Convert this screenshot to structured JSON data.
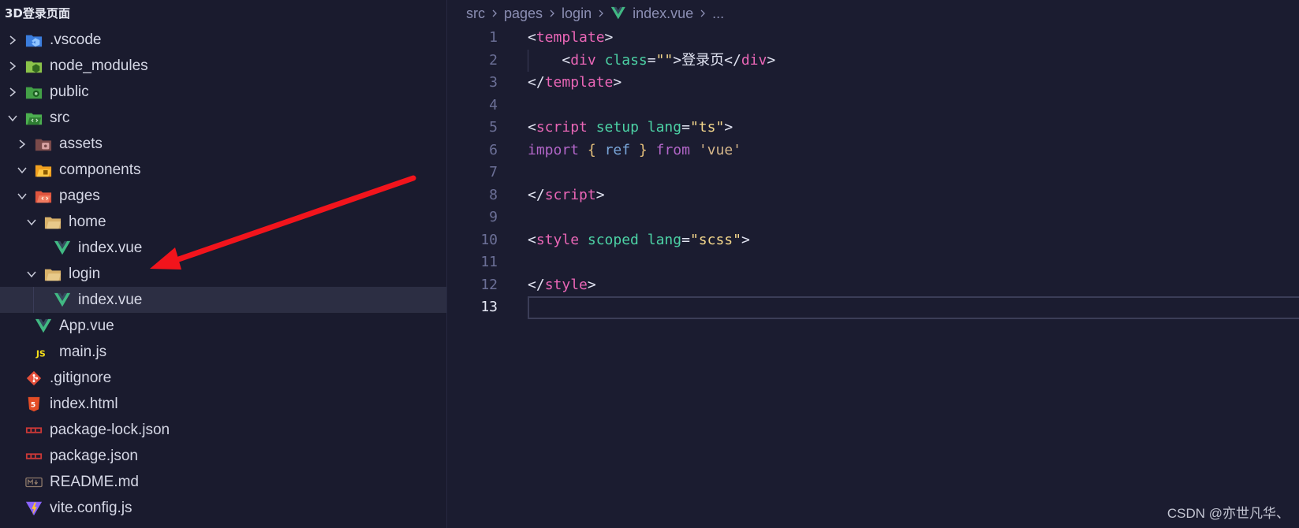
{
  "explorer": {
    "title": "3D登录页面",
    "items": [
      {
        "label": ".vscode",
        "depth": 0,
        "chevron": "right",
        "icon": "vscode-folder-icon"
      },
      {
        "label": "node_modules",
        "depth": 0,
        "chevron": "right",
        "icon": "node-folder-icon"
      },
      {
        "label": "public",
        "depth": 0,
        "chevron": "right",
        "icon": "public-folder-icon"
      },
      {
        "label": "src",
        "depth": 0,
        "chevron": "down",
        "icon": "src-folder-icon"
      },
      {
        "label": "assets",
        "depth": 1,
        "chevron": "right",
        "icon": "assets-folder-icon"
      },
      {
        "label": "components",
        "depth": 1,
        "chevron": "down",
        "icon": "components-folder-icon"
      },
      {
        "label": "pages",
        "depth": 1,
        "chevron": "down",
        "icon": "pages-folder-icon"
      },
      {
        "label": "home",
        "depth": 2,
        "chevron": "down",
        "icon": "folder-open-icon"
      },
      {
        "label": "index.vue",
        "depth": 3,
        "chevron": "none",
        "icon": "vue-icon"
      },
      {
        "label": "login",
        "depth": 2,
        "chevron": "down",
        "icon": "folder-open-icon"
      },
      {
        "label": "index.vue",
        "depth": 3,
        "chevron": "none",
        "icon": "vue-icon",
        "selected": true
      },
      {
        "label": "App.vue",
        "depth": 1,
        "chevron": "none",
        "icon": "vue-icon"
      },
      {
        "label": "main.js",
        "depth": 1,
        "chevron": "none",
        "icon": "js-icon"
      },
      {
        "label": ".gitignore",
        "depth": 0,
        "chevron": "none",
        "icon": "git-icon"
      },
      {
        "label": "index.html",
        "depth": 0,
        "chevron": "none",
        "icon": "html5-icon"
      },
      {
        "label": "package-lock.json",
        "depth": 0,
        "chevron": "none",
        "icon": "npm-icon"
      },
      {
        "label": "package.json",
        "depth": 0,
        "chevron": "none",
        "icon": "npm-icon"
      },
      {
        "label": "README.md",
        "depth": 0,
        "chevron": "none",
        "icon": "markdown-icon"
      },
      {
        "label": "vite.config.js",
        "depth": 0,
        "chevron": "none",
        "icon": "vite-icon"
      }
    ]
  },
  "breadcrumb": {
    "segments": [
      "src",
      "pages",
      "login",
      "index.vue",
      "..."
    ]
  },
  "editor": {
    "active_line": 13,
    "lines": [
      {
        "n": "1",
        "tokens": [
          [
            "t-punc",
            "<"
          ],
          [
            "t-tag",
            "template"
          ],
          [
            "t-punc",
            ">"
          ]
        ]
      },
      {
        "n": "2",
        "tokens": [
          [
            "t-text",
            "    "
          ],
          [
            "t-punc",
            "<"
          ],
          [
            "t-tag",
            "div"
          ],
          [
            "t-text",
            " "
          ],
          [
            "t-attr",
            "class"
          ],
          [
            "t-punc",
            "="
          ],
          [
            "t-str",
            "\"\""
          ],
          [
            "t-punc",
            ">"
          ],
          [
            "t-text",
            "登录页"
          ],
          [
            "t-punc",
            "</"
          ],
          [
            "t-tag",
            "div"
          ],
          [
            "t-punc",
            ">"
          ]
        ]
      },
      {
        "n": "3",
        "tokens": [
          [
            "t-punc",
            "</"
          ],
          [
            "t-tag",
            "template"
          ],
          [
            "t-punc",
            ">"
          ]
        ]
      },
      {
        "n": "4",
        "tokens": []
      },
      {
        "n": "5",
        "tokens": [
          [
            "t-punc",
            "<"
          ],
          [
            "t-tag",
            "script"
          ],
          [
            "t-text",
            " "
          ],
          [
            "t-attr",
            "setup"
          ],
          [
            "t-text",
            " "
          ],
          [
            "t-attr",
            "lang"
          ],
          [
            "t-punc",
            "="
          ],
          [
            "t-str",
            "\"ts\""
          ],
          [
            "t-punc",
            ">"
          ]
        ]
      },
      {
        "n": "6",
        "tokens": [
          [
            "t-kw",
            "import"
          ],
          [
            "t-text",
            " "
          ],
          [
            "t-brace",
            "{"
          ],
          [
            "t-text",
            " "
          ],
          [
            "t-var",
            "ref"
          ],
          [
            "t-text",
            " "
          ],
          [
            "t-brace",
            "}"
          ],
          [
            "t-text",
            " "
          ],
          [
            "t-kw",
            "from"
          ],
          [
            "t-text",
            " "
          ],
          [
            "t-quote",
            "'vue'"
          ]
        ]
      },
      {
        "n": "7",
        "tokens": []
      },
      {
        "n": "8",
        "tokens": [
          [
            "t-punc",
            "</"
          ],
          [
            "t-tag",
            "script"
          ],
          [
            "t-punc",
            ">"
          ]
        ]
      },
      {
        "n": "9",
        "tokens": []
      },
      {
        "n": "10",
        "tokens": [
          [
            "t-punc",
            "<"
          ],
          [
            "t-tag",
            "style"
          ],
          [
            "t-text",
            " "
          ],
          [
            "t-attr",
            "scoped"
          ],
          [
            "t-text",
            " "
          ],
          [
            "t-attr",
            "lang"
          ],
          [
            "t-punc",
            "="
          ],
          [
            "t-str",
            "\"scss\""
          ],
          [
            "t-punc",
            ">"
          ]
        ]
      },
      {
        "n": "11",
        "tokens": []
      },
      {
        "n": "12",
        "tokens": [
          [
            "t-punc",
            "</"
          ],
          [
            "t-tag",
            "style"
          ],
          [
            "t-punc",
            ">"
          ]
        ]
      },
      {
        "n": "13",
        "tokens": []
      }
    ]
  },
  "watermark": "CSDN @亦世凡华、",
  "colors": {
    "background": "#1a1b2e",
    "selection": "#2c2e43",
    "arrow": "#f2141c",
    "tag": "#e966b6",
    "attr": "#4cd2a5",
    "string": "#f4d78c",
    "keyword": "#b266c8"
  }
}
